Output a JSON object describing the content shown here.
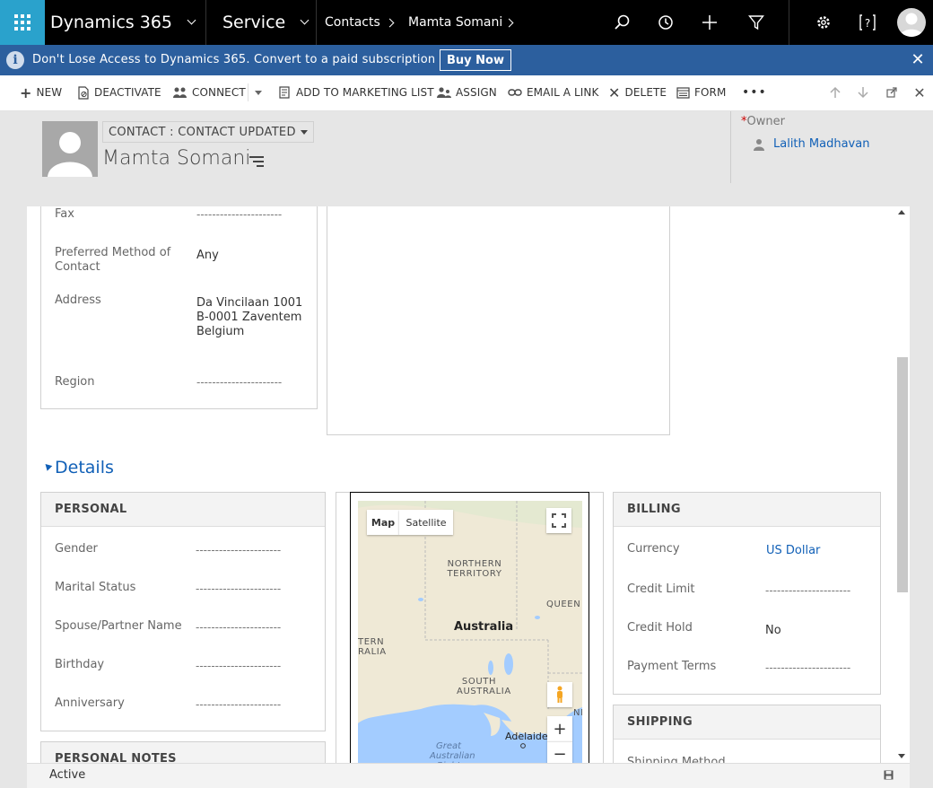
{
  "topbar": {
    "app_name": "Dynamics 365",
    "module": "Service",
    "crumbs": [
      "Contacts",
      "Mamta Somani"
    ]
  },
  "notice": {
    "info_glyph": "i",
    "text": "Don't Lose Access to Dynamics 365. Convert to a paid subscription",
    "buy_label": "Buy Now",
    "close_glyph": "✕"
  },
  "commands": {
    "new": "NEW",
    "deactivate": "DEACTIVATE",
    "connect": "CONNECT",
    "add_to_marketing_list": "ADD TO MARKETING LIST",
    "assign": "ASSIGN",
    "email_link": "EMAIL A LINK",
    "delete": "DELETE",
    "form": "FORM",
    "more": "•••"
  },
  "header": {
    "form_selector": "CONTACT : CONTACT UPDATED",
    "record_name": "Mamta Somani",
    "owner_required": "*",
    "owner_label": "Owner",
    "owner_value": "Lalith Madhavan"
  },
  "contact_section": {
    "fax_label": "Fax",
    "fax_value": "----------------------",
    "preferred_label": "Preferred Method of Contact",
    "preferred_value": "Any",
    "address_label": "Address",
    "address_line1": "Da Vincilaan 1001",
    "address_line2": "B-0001 Zaventem",
    "address_line3": "Belgium",
    "region_label": "Region",
    "region_value": "----------------------"
  },
  "details": {
    "title": "Details",
    "personal": {
      "heading": "PERSONAL",
      "fields": [
        {
          "label": "Gender",
          "value": "----------------------"
        },
        {
          "label": "Marital Status",
          "value": "----------------------"
        },
        {
          "label": "Spouse/Partner Name",
          "value": "----------------------"
        },
        {
          "label": "Birthday",
          "value": "----------------------"
        },
        {
          "label": "Anniversary",
          "value": "----------------------"
        }
      ]
    },
    "personal_notes_heading": "PERSONAL NOTES",
    "billing": {
      "heading": "BILLING",
      "currency_label": "Currency",
      "currency_value": "US Dollar",
      "credit_limit_label": "Credit Limit",
      "credit_limit_value": "----------------------",
      "credit_hold_label": "Credit Hold",
      "credit_hold_value": "No",
      "payment_terms_label": "Payment Terms",
      "payment_terms_value": "----------------------"
    },
    "shipping": {
      "heading": "SHIPPING",
      "shipping_method_label": "Shipping Method"
    }
  },
  "map": {
    "map_tab": "Map",
    "satellite_tab": "Satellite",
    "country": "Australia",
    "region_nt": "NORTHERN TERRITORY",
    "region_qld": "QUEEN",
    "region_wa": "TERN RALIA",
    "region_sa": "SOUTH AUSTRALIA",
    "region_nsw": "NI",
    "city": "Adelaide",
    "bight": "Great Australian Bight",
    "zoom_in": "+",
    "zoom_out": "−"
  },
  "footer": {
    "status": "Active"
  },
  "colors": {
    "waffle": "#2aa2cc",
    "notice": "#2c5f9e",
    "link": "#1160b7",
    "section_accent": "#1160b7"
  }
}
